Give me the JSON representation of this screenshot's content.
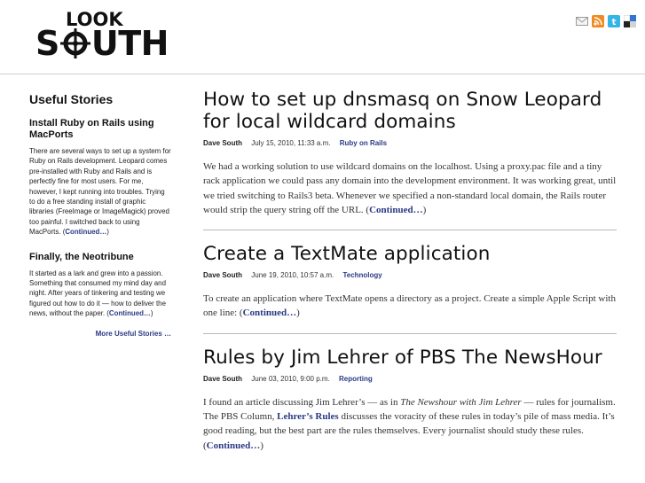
{
  "header": {
    "logo_top": "LOOK",
    "logo_bottom_1": "S",
    "logo_bottom_2": "UTH",
    "icons": [
      "email-icon",
      "rss-icon",
      "twitter-icon",
      "delicious-icon"
    ]
  },
  "sidebar": {
    "heading": "Useful Stories",
    "stories": [
      {
        "title": "Install Ruby on Rails using MacPorts",
        "body": "There are several ways to set up a system for Ruby on Rails development. Leopard comes pre-installed with Ruby and Rails and is perfectly fine for most users. For me, however, I kept running into troubles. Trying to do a free standing install of graphic libraries (FreeImage or ImageMagick) proved too painful. I switched back to using MacPorts. (",
        "cont": "Continued…",
        "close": ")"
      },
      {
        "title": "Finally, the Neotribune",
        "body": "It started as a lark and grew into a passion. Something that consumed my mind day and night. After years of tinkering and testing we figured out how to do it — how to deliver the news, without the paper. (",
        "cont": "Continued…",
        "close": ")"
      }
    ],
    "more": "More Useful Stories …"
  },
  "posts": [
    {
      "title": "How to set up dnsmasq on Snow Leopard for local wildcard domains",
      "author": "Dave South",
      "date": "July 15, 2010, 11:33 a.m.",
      "category": "Ruby on Rails",
      "excerpt": "We had a working solution to use wildcard domains on the localhost. Using a proxy.pac file and a tiny rack application we could pass any domain into the development environment. It was working great, until we tried switching to Rails3 beta. Whenever we specified a non-standard local domain, the Rails router would strip the query string off the URL. (",
      "cont": "Continued…",
      "close": ")"
    },
    {
      "title": "Create a TextMate application",
      "author": "Dave South",
      "date": "June 19, 2010, 10:57 a.m.",
      "category": "Technology",
      "excerpt": "To create an application where TextMate opens a directory as a project. Create a simple Apple Script with one line: (",
      "cont": "Continued…",
      "close": ")"
    },
    {
      "title": "Rules by Jim Lehrer of PBS The NewsHour",
      "author": "Dave South",
      "date": "June 03, 2010, 9:00 p.m.",
      "category": "Reporting",
      "excerpt_a": "I found an article discussing Jim Lehrer’s — as in ",
      "excerpt_em": "The Newshour with Jim Lehrer",
      "excerpt_b": " — rules for journalism. The PBS Column, ",
      "excerpt_link": "Lehrer’s Rules",
      "excerpt_c": " discusses the voracity of these rules in today’s pile of mass media. It’s good reading, but the best part are the rules themselves. Every journalist should study these rules. (",
      "cont": "Continued…",
      "close": ")"
    }
  ]
}
